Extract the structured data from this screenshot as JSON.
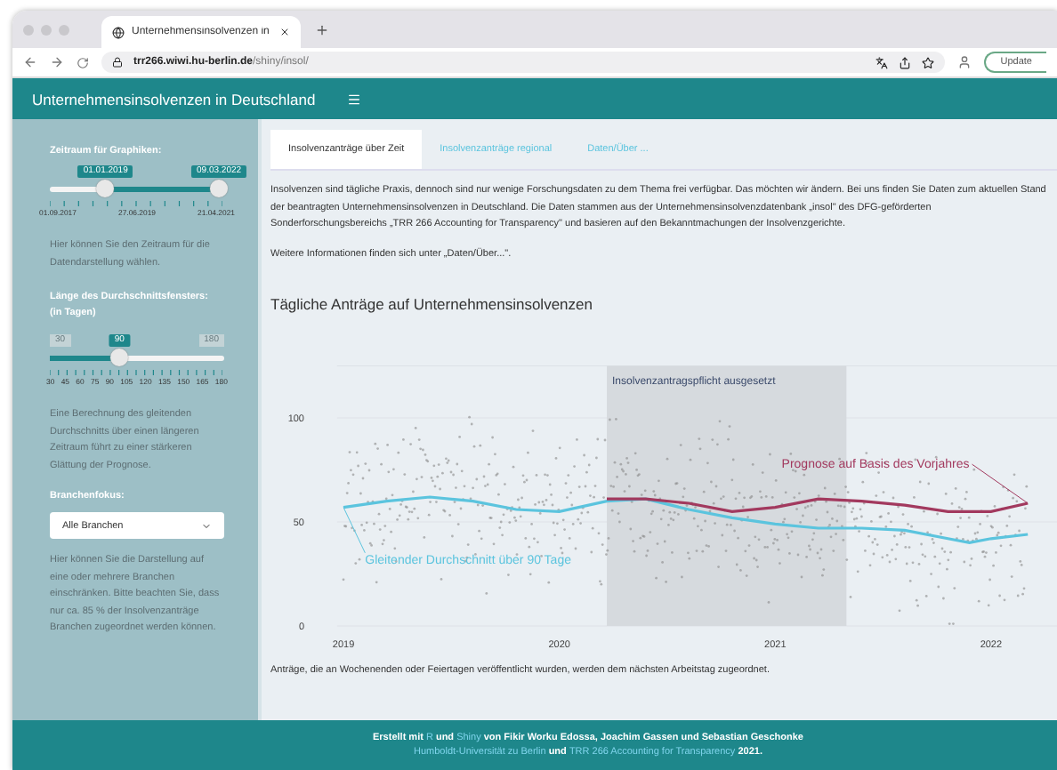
{
  "browser": {
    "tab_title": "Unternehmensinsolvenzen in",
    "url_host": "trr266.wiwi.hu-berlin.de",
    "url_path": "/shiny/insol/",
    "update_button": "Update"
  },
  "header": {
    "title": "Unternehmensinsolvenzen in Deutschland"
  },
  "sidebar": {
    "period": {
      "label": "Zeitraum für Graphiken:",
      "handles": [
        {
          "value": "01.01.2019",
          "level": 0.32
        },
        {
          "value": "09.03.2022",
          "level": 0.97
        }
      ],
      "ticks": [
        "01.09.2017",
        "27.06.2019",
        "21.04.2021"
      ],
      "help": "Hier können Sie den Zeitraum für die Datendarstellung wählen."
    },
    "window": {
      "label": "Länge des Durchschnittsfensters: (in Tagen)",
      "min": "30",
      "max": "180",
      "value": "90",
      "level": 0.4,
      "ticks": [
        "30",
        "45",
        "60",
        "75",
        "90",
        "105",
        "120",
        "135",
        "150",
        "165",
        "180"
      ],
      "help": "Eine Berechnung des gleitenden Durchschnitts über einen längeren Zeitraum führt zu einer stärkeren Glättung der Prognose."
    },
    "branch": {
      "label": "Branchenfokus:",
      "value": "Alle Branchen",
      "help": "Hier können Sie die Darstellung auf eine oder mehrere Branchen einschränken. Bitte beachten Sie, dass nur ca. 85 % der Insolvenzanträge Branchen zugeordnet werden können."
    }
  },
  "tabs": [
    {
      "label": "Insolvenzanträge über Zeit",
      "selected": true
    },
    {
      "label": "Insolvenzanträge regional",
      "selected": false
    },
    {
      "label": "Daten/Über ...",
      "selected": false
    }
  ],
  "intro": [
    "Insolvenzen sind tägliche Praxis, dennoch sind nur wenige Forschungsdaten zu dem Thema frei verfügbar. Das möchten wir ändern. Bei uns finden Sie Daten zum aktuellen Stand der beantragten Unternehmensinsolvenzen in Deutschland. Die Daten stammen aus der Unternehmensinsolvenzdatenbank „insol\" des DFG-geförderten Sonderforschungsbereichs „TRR 266 Accounting for Transparency\" und basieren auf den Bekanntmachungen der Insolvenzgerichte.",
    "Weitere Informationen finden sich unter „Daten/Über...\"."
  ],
  "chart_heading": "Tägliche Anträge auf Unternehmensinsolvenzen",
  "chart_data": {
    "type": "line",
    "x": [
      2019.0,
      2019.2,
      2019.4,
      2019.6,
      2019.8,
      2020.0,
      2020.22,
      2020.4,
      2020.6,
      2020.8,
      2021.0,
      2021.2,
      2021.4,
      2021.6,
      2021.8,
      2021.9,
      2022.0,
      2022.17
    ],
    "series": [
      {
        "name": "Gleitender Durchschnitt über 90 Tage",
        "color": "#5bc4de",
        "values": [
          57,
          60,
          62,
          60,
          56,
          55,
          60,
          61,
          56,
          52,
          49,
          47,
          47,
          46,
          42,
          40,
          42,
          44
        ]
      },
      {
        "name": "Prognose auf Basis des Vorjahres",
        "color": "#a2395e",
        "values": [
          null,
          null,
          null,
          null,
          null,
          null,
          61,
          61,
          59,
          55,
          57,
          61,
          60,
          58,
          55,
          55,
          55,
          59
        ]
      }
    ],
    "xlim": [
      2018.97,
      2022.35
    ],
    "ylim": [
      0,
      125
    ],
    "yticks": [
      0,
      50,
      100
    ],
    "xticks": [
      {
        "value": 2019,
        "label": "2019"
      },
      {
        "value": 2020,
        "label": "2020"
      },
      {
        "value": 2021,
        "label": "2021"
      },
      {
        "value": 2022,
        "label": "2022"
      }
    ],
    "annotations": [
      "Insolvenzantragspflicht ausgesetzt"
    ]
  },
  "note": "Anträge, die an Wochenenden oder Feiertagen veröffentlicht wurden, werden dem nächsten Arbeitstag zugeordnet.",
  "footer": [
    [
      {
        "text": "Erstellt mit ",
        "link": false
      },
      {
        "text": "R",
        "link": true
      },
      {
        "text": " und ",
        "link": false
      },
      {
        "text": "Shiny",
        "link": true
      },
      {
        "text": " von Fikir Worku Edossa, Joachim Gassen und Sebastian Geschonke",
        "link": false
      }
    ],
    [
      {
        "text": "Humboldt-Universität zu Berlin",
        "link": true
      },
      {
        "text": " und ",
        "link": false
      },
      {
        "text": "TRR 266 Accounting for Transparency",
        "link": true
      },
      {
        "text": " 2021.",
        "link": false
      }
    ]
  ]
}
